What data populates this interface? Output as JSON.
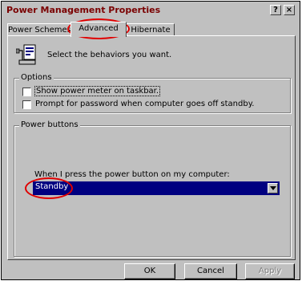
{
  "window": {
    "title": "Power Management Properties",
    "help_button": "?",
    "close_button": "×"
  },
  "tabs": [
    {
      "label": "Power Schemes"
    },
    {
      "label": "Advanced"
    },
    {
      "label": "Hibernate"
    }
  ],
  "advanced": {
    "intro_text": "Select the behaviors you want.",
    "options_label": "Options",
    "show_meter_label": "Show power meter on taskbar.",
    "password_label": "Prompt for password when computer goes off standby.",
    "power_buttons_label": "Power buttons",
    "power_button_prompt": "When I press the power button on my computer:",
    "power_button_value": "Standby"
  },
  "buttons": {
    "ok": "OK",
    "cancel": "Cancel",
    "apply": "Apply"
  },
  "colors": {
    "annotation_red": "#e00000",
    "select_highlight": "#000080",
    "title_text": "#7a0000"
  }
}
